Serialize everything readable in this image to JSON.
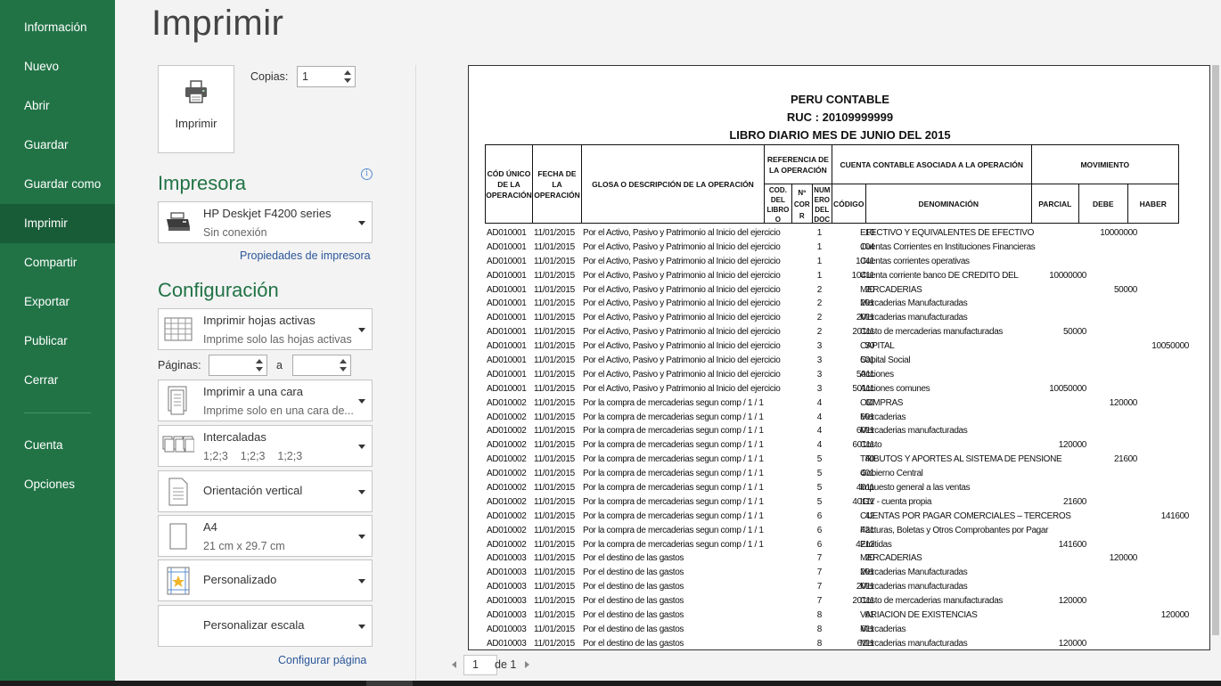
{
  "sidebar": {
    "items": [
      "Información",
      "Nuevo",
      "Abrir",
      "Guardar",
      "Guardar como",
      "Imprimir",
      "Compartir",
      "Exportar",
      "Publicar",
      "Cerrar"
    ],
    "active": "Imprimir",
    "bottom_items": [
      "Cuenta",
      "Opciones"
    ]
  },
  "page_title": "Imprimir",
  "print_button_label": "Imprimir",
  "copies": {
    "label": "Copias:",
    "value": "1"
  },
  "printer": {
    "section_title": "Impresora",
    "name": "HP Deskjet F4200 series",
    "status": "Sin conexión",
    "properties_link": "Propiedades de impresora"
  },
  "settings": {
    "section_title": "Configuración",
    "what": {
      "main": "Imprimir hojas activas",
      "sub": "Imprime solo las hojas activas"
    },
    "pages_label": "Páginas:",
    "pages_to": "a",
    "pages_from_value": "",
    "pages_to_value": "",
    "sides": {
      "main": "Imprimir a una cara",
      "sub": "Imprime solo en una cara de..."
    },
    "collate": {
      "main": "Intercaladas",
      "sub": "1;2;3    1;2;3    1;2;3"
    },
    "orientation": {
      "main": "Orientación vertical"
    },
    "paper": {
      "main": "A4",
      "sub": "21 cm x 29.7 cm"
    },
    "margins": {
      "main": "Personalizado"
    },
    "scaling": {
      "main": "Personalizar escala"
    },
    "page_setup_link": "Configurar página"
  },
  "preview": {
    "header_lines": [
      "PERU CONTABLE",
      "RUC : 20109999999",
      "LIBRO DIARIO MES DE  JUNIO DEL 2015"
    ],
    "columns": {
      "codigo_unico": "CÓD ÚNICO DE LA OPERACIÓN",
      "fecha": "FECHA DE LA OPERACIÓN",
      "glosa": "GLOSA O DESCRIPCIÓN DE LA OPERACIÓN",
      "referencia": "REFERENCIA DE LA OPERACIÓN",
      "cod_libro": "COD. DEL LIBRO O REGIST",
      "num_cor": "Nº COR R",
      "num_doc": "NUM ERO DEL DOC",
      "cuenta": "CUENTA CONTABLE ASOCIADA A LA OPERACIÓN",
      "codigo": "CÓDIGO",
      "denominacion": "DENOMINACIÓN",
      "movimiento": "MOVIMIENTO",
      "parcial": "PARCIAL",
      "debe": "DEBE",
      "haber": "HABER"
    },
    "rows": [
      [
        "AD010001",
        "11/01/2015",
        "Por el Activo, Pasivo y Patrimonio al Inicio del ejercicio",
        "1",
        "10",
        "EFECTIVO Y EQUIVALENTES DE EFECTIVO",
        "",
        "10000000",
        ""
      ],
      [
        "AD010001",
        "11/01/2015",
        "Por el Activo, Pasivo y Patrimonio al Inicio del ejercicio",
        "1",
        "104",
        "Cuentas Corrientes en Instituciones Financieras",
        "",
        "",
        ""
      ],
      [
        "AD010001",
        "11/01/2015",
        "Por el Activo, Pasivo y Patrimonio al Inicio del ejercicio",
        "1",
        "1041",
        "Cuentas corrientes operativas",
        "",
        "",
        ""
      ],
      [
        "AD010001",
        "11/01/2015",
        "Por el Activo, Pasivo y Patrimonio al Inicio del ejercicio",
        "1",
        "10411",
        "Cuenta corriente banco DE CREDITO DEL",
        "10000000",
        "",
        ""
      ],
      [
        "AD010001",
        "11/01/2015",
        "Por el Activo, Pasivo y Patrimonio al Inicio del ejercicio",
        "2",
        "20",
        "MERCADERIAS",
        "",
        "50000",
        ""
      ],
      [
        "AD010001",
        "11/01/2015",
        "Por el Activo, Pasivo y Patrimonio al Inicio del ejercicio",
        "2",
        "201",
        "Mercaderias Manufacturadas",
        "",
        "",
        ""
      ],
      [
        "AD010001",
        "11/01/2015",
        "Por el Activo, Pasivo y Patrimonio al Inicio del ejercicio",
        "2",
        "2011",
        "Mercaderias manufacturadas",
        "",
        "",
        ""
      ],
      [
        "AD010001",
        "11/01/2015",
        "Por el Activo, Pasivo y Patrimonio al Inicio del ejercicio",
        "2",
        "20111",
        "Costo de mercaderias manufacturadas",
        "50000",
        "",
        ""
      ],
      [
        "AD010001",
        "11/01/2015",
        "Por el Activo, Pasivo y Patrimonio al Inicio del ejercicio",
        "3",
        "50",
        "CAPITAL",
        "",
        "",
        "10050000"
      ],
      [
        "AD010001",
        "11/01/2015",
        "Por el Activo, Pasivo y Patrimonio al Inicio del ejercicio",
        "3",
        "501",
        "Capital Social",
        "",
        "",
        ""
      ],
      [
        "AD010001",
        "11/01/2015",
        "Por el Activo, Pasivo y Patrimonio al Inicio del ejercicio",
        "3",
        "5011",
        "Acciones",
        "",
        "",
        ""
      ],
      [
        "AD010001",
        "11/01/2015",
        "Por el Activo, Pasivo y Patrimonio al Inicio del ejercicio",
        "3",
        "50111",
        "Acciones comunes",
        "10050000",
        "",
        ""
      ],
      [
        "AD010002",
        "11/01/2015",
        "Por la compra de mercaderias segun comp / 1 / 1",
        "4",
        "60",
        "COMPRAS",
        "",
        "120000",
        ""
      ],
      [
        "AD010002",
        "11/01/2015",
        "Por la compra de mercaderias segun comp / 1 / 1",
        "4",
        "601",
        "Mercaderias",
        "",
        "",
        ""
      ],
      [
        "AD010002",
        "11/01/2015",
        "Por la compra de mercaderias segun comp / 1 / 1",
        "4",
        "6011",
        "Mercaderias manufacturadas",
        "",
        "",
        ""
      ],
      [
        "AD010002",
        "11/01/2015",
        "Por la compra de mercaderias segun comp / 1 / 1",
        "4",
        "60111",
        "Costo",
        "120000",
        "",
        ""
      ],
      [
        "AD010002",
        "11/01/2015",
        "Por la compra de mercaderias segun comp / 1 / 1",
        "5",
        "40",
        "TRIBUTOS Y APORTES AL SISTEMA DE PENSIONE",
        "",
        "21600",
        ""
      ],
      [
        "AD010002",
        "11/01/2015",
        "Por la compra de mercaderias segun comp / 1 / 1",
        "5",
        "401",
        "Gobierno Central",
        "",
        "",
        ""
      ],
      [
        "AD010002",
        "11/01/2015",
        "Por la compra de mercaderias segun comp / 1 / 1",
        "5",
        "4011",
        "Impuesto general a las ventas",
        "",
        "",
        ""
      ],
      [
        "AD010002",
        "11/01/2015",
        "Por la compra de mercaderias segun comp / 1 / 1",
        "5",
        "40111",
        "IGV - cuenta propia",
        "21600",
        "",
        ""
      ],
      [
        "AD010002",
        "11/01/2015",
        "Por la compra de mercaderias segun comp / 1 / 1",
        "6",
        "42",
        "CUENTAS POR PAGAR COMERCIALES – TERCEROS",
        "",
        "",
        "141600"
      ],
      [
        "AD010002",
        "11/01/2015",
        "Por la compra de mercaderias segun comp / 1 / 1",
        "6",
        "421",
        "Facturas, Boletas y Otros Comprobantes por Pagar",
        "",
        "",
        ""
      ],
      [
        "AD010002",
        "11/01/2015",
        "Por la compra de mercaderias segun comp / 1 / 1",
        "6",
        "4212",
        "Emitidas",
        "141600",
        "",
        ""
      ],
      [
        "AD010003",
        "11/01/2015",
        "Por el destino de las gastos",
        "7",
        "20",
        "MERCADERÍAS",
        "",
        "120000",
        ""
      ],
      [
        "AD010003",
        "11/01/2015",
        "Por el destino de las gastos",
        "7",
        "201",
        "Mercaderias Manufacturadas",
        "",
        "",
        ""
      ],
      [
        "AD010003",
        "11/01/2015",
        "Por el destino de las gastos",
        "7",
        "2011",
        "Mercaderias manufacturadas",
        "",
        "",
        ""
      ],
      [
        "AD010003",
        "11/01/2015",
        "Por el destino de las gastos",
        "7",
        "20111",
        "Costo de mercaderias manufacturadas",
        "120000",
        "",
        ""
      ],
      [
        "AD010003",
        "11/01/2015",
        "Por el destino de las gastos",
        "8",
        "61",
        "VARIACIÓN DE EXISTENCIAS",
        "",
        "",
        "120000"
      ],
      [
        "AD010003",
        "11/01/2015",
        "Por el destino de las gastos",
        "8",
        "611",
        "Mercaderias",
        "",
        "",
        ""
      ],
      [
        "AD010003",
        "11/01/2015",
        "Por el destino de las gastos",
        "8",
        "6111",
        "Mercaderias manufacturadas",
        "120000",
        "",
        ""
      ]
    ]
  },
  "pager": {
    "current": "1",
    "of_label": "de 1"
  },
  "colors": {
    "accent": "#217346",
    "accent_dark": "#185c37",
    "link": "#2b579a"
  }
}
